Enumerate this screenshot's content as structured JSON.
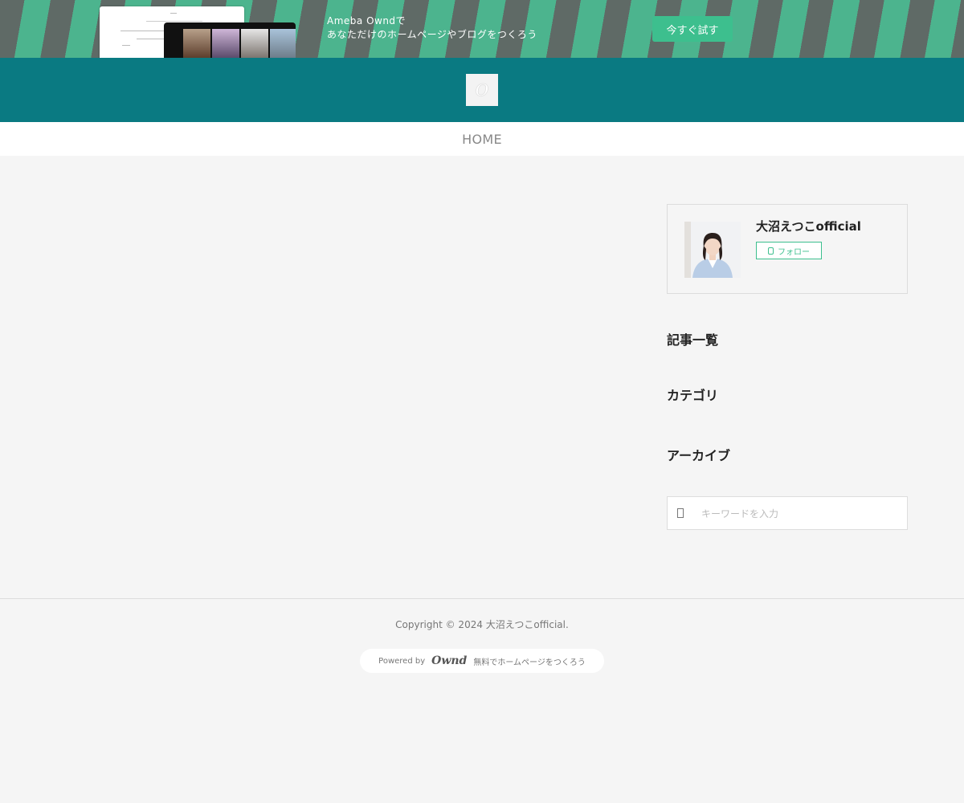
{
  "promo": {
    "line1": "Ameba Owndで",
    "line2": "あなただけのホームページやブログをつくろう",
    "cta": "今すぐ試す"
  },
  "header": {
    "logo_glyph": "O"
  },
  "nav": {
    "home": "HOME"
  },
  "sidebar": {
    "profile_name": "大沼えつこofficial",
    "follow_label": "フォロー",
    "articles_heading": "記事一覧",
    "category_heading": "カテゴリ",
    "archive_heading": "アーカイブ",
    "search_placeholder": "キーワードを入力"
  },
  "footer": {
    "copyright": "Copyright © 2024 大沼えつこofficial.",
    "powered_by": "Powered by",
    "brand": "Ownd",
    "tagline": "無料でホームページをつくろう"
  },
  "colors": {
    "accent": "#3dbf8e",
    "header": "#0a7a82"
  }
}
